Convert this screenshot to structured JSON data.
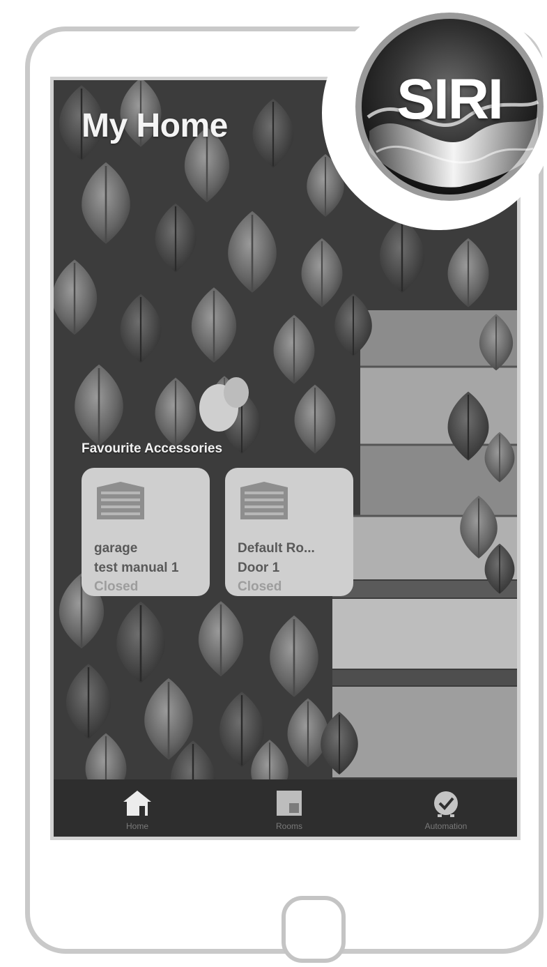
{
  "home": {
    "title": "My Home"
  },
  "favourites": {
    "header": "Favourite Accessories",
    "tiles": [
      {
        "icon": "garage-door-icon",
        "name_line1": "garage",
        "name_line2": "test manual 1",
        "status": "Closed"
      },
      {
        "icon": "garage-door-icon",
        "name_line1": "Default Ro...",
        "name_line2": "Door 1",
        "status": "Closed"
      }
    ]
  },
  "tabbar": {
    "items": [
      {
        "icon": "house-icon",
        "label": "Home"
      },
      {
        "icon": "rooms-icon",
        "label": "Rooms"
      },
      {
        "icon": "clock-icon",
        "label": "Automation"
      }
    ]
  },
  "badge": {
    "text": "SIRI"
  },
  "colors": {
    "tile_background": "#cfcfcf",
    "tabbar_background": "#2e2e2e",
    "phone_outline": "#c9c9c9"
  }
}
